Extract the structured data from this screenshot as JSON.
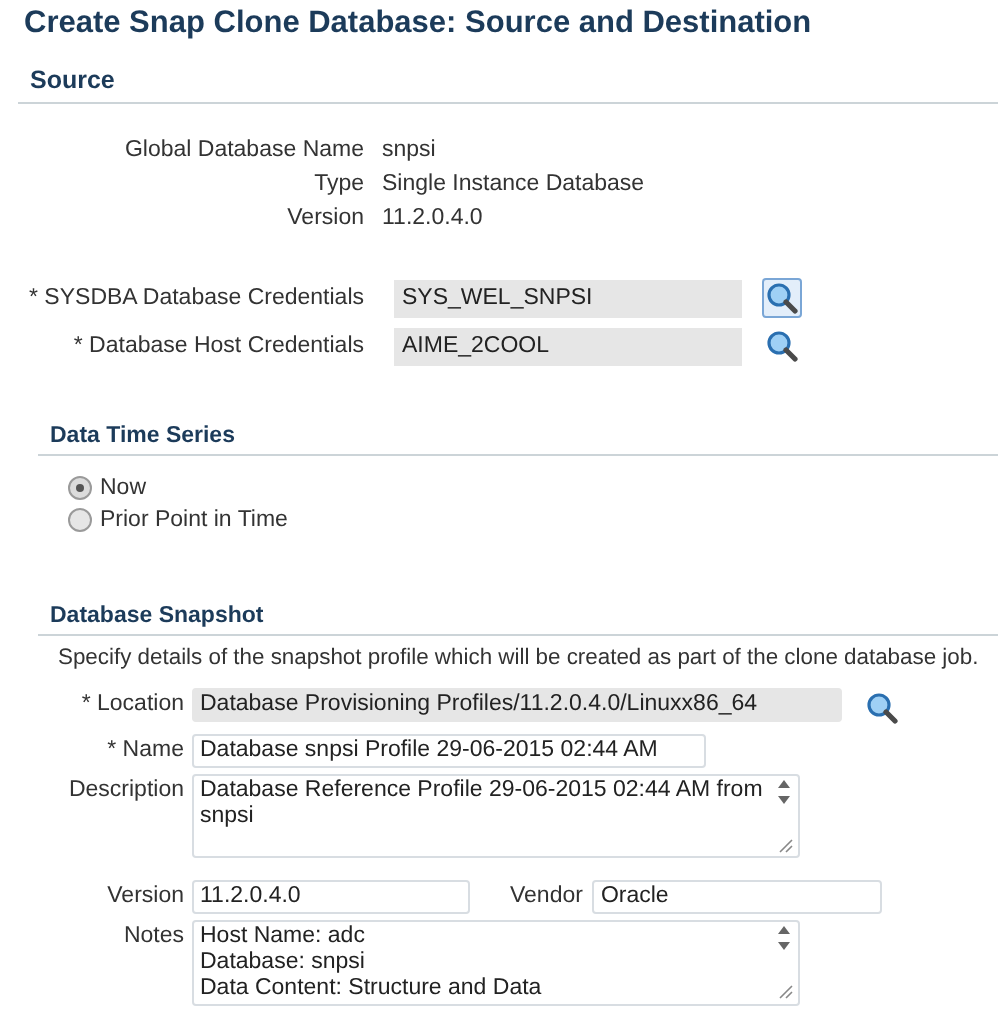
{
  "title": "Create Snap Clone Database: Source and Destination",
  "source": {
    "heading": "Source",
    "info": [
      {
        "label": "Global Database Name",
        "value": "snpsi"
      },
      {
        "label": "Type",
        "value": "Single Instance Database"
      },
      {
        "label": "Version",
        "value": "11.2.0.4.0"
      }
    ],
    "credentials": [
      {
        "label": "* SYSDBA Database Credentials",
        "value": "SYS_WEL_SNPSI",
        "hovered": true
      },
      {
        "label": "* Database Host Credentials",
        "value": "AIME_2COOL",
        "hovered": false
      }
    ]
  },
  "time_series": {
    "heading": "Data Time Series",
    "options": [
      {
        "label": "Now",
        "selected": true
      },
      {
        "label": "Prior Point in Time",
        "selected": false
      }
    ]
  },
  "snapshot": {
    "heading": "Database Snapshot",
    "intro": "Specify details of the snapshot profile which will be created as part of the clone database job.",
    "fields": [
      {
        "kind": "lookup",
        "label": "* Location",
        "value": "Database Provisioning Profiles/11.2.0.4.0/Linuxx86_64"
      },
      {
        "kind": "text",
        "label": "* Name",
        "value": "Database snpsi  Profile 29-06-2015 02:44 AM"
      },
      {
        "kind": "textarea",
        "label": "Description",
        "lines": [
          "Database Reference Profile 29-06-2015 02:44 AM from",
          "snpsi"
        ]
      },
      {
        "kind": "pair",
        "label": "Version",
        "value": "11.2.0.4.0",
        "label2": "Vendor",
        "value2": "Oracle"
      },
      {
        "kind": "textarea",
        "label": "Notes",
        "lines": [
          "Host Name: adc",
          "Database: snpsi",
          "Data Content: Structure and Data"
        ]
      }
    ]
  }
}
